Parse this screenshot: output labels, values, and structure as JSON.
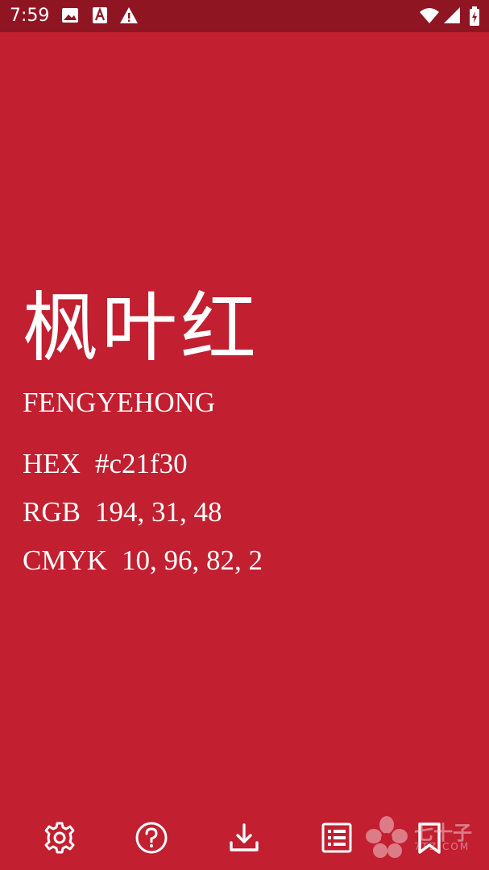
{
  "status_bar": {
    "time": "7:59",
    "left_icons": [
      "image-icon",
      "a-box-icon",
      "warning-icon"
    ],
    "right_icons": [
      "wifi-icon",
      "signal-icon",
      "battery-icon"
    ]
  },
  "color": {
    "name_zh": "枫叶红",
    "pinyin": "FENGYEHONG",
    "background": "#c21f30",
    "codes": [
      {
        "label": "HEX",
        "value": "#c21f30"
      },
      {
        "label": "RGB",
        "value": "194, 31, 48"
      },
      {
        "label": "CMYK",
        "value": "10, 96, 82, 2"
      }
    ]
  },
  "toolbar": {
    "icons": [
      "settings-icon",
      "help-icon",
      "download-icon",
      "list-icon",
      "bookmark-icon"
    ]
  },
  "watermark": {
    "text": "七十子",
    "sub": "7TZ.COM"
  }
}
